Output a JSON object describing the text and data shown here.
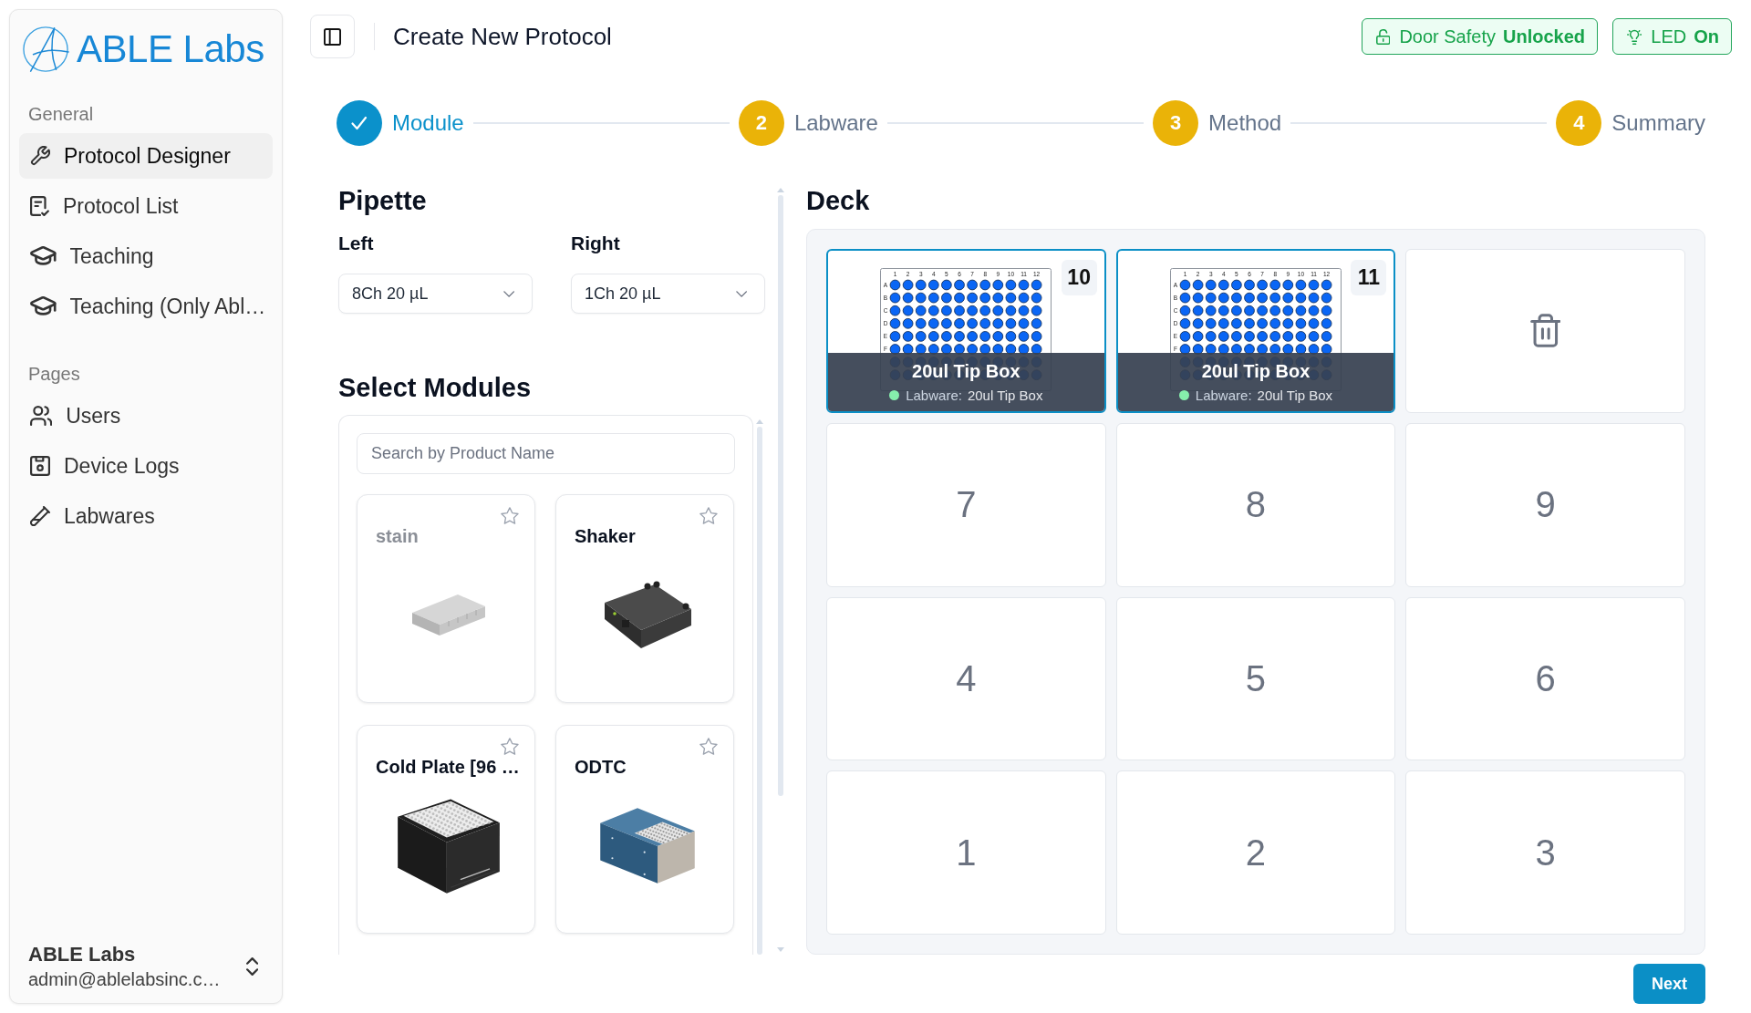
{
  "sidebar": {
    "logo": {
      "text": "ABLE Labs"
    },
    "sections": [
      {
        "label": "General",
        "items": [
          {
            "label": "Protocol Designer",
            "selected": true
          },
          {
            "label": "Protocol List",
            "selected": false
          },
          {
            "label": "Teaching",
            "selected": false
          },
          {
            "label": "Teaching (Only Abl…",
            "selected": false
          }
        ]
      },
      {
        "label": "Pages",
        "items": [
          {
            "label": "Users",
            "selected": false
          },
          {
            "label": "Device Logs",
            "selected": false
          },
          {
            "label": "Labwares",
            "selected": false
          }
        ]
      }
    ],
    "account": {
      "name": "ABLE Labs",
      "email": "admin@ablelabsinc.c…"
    }
  },
  "header": {
    "title": "Create New Protocol",
    "badges": [
      {
        "label": "Door Safety",
        "value": "Unlocked"
      },
      {
        "label": "LED",
        "value": "On"
      }
    ]
  },
  "steps": [
    {
      "label": "Module",
      "completed": true
    },
    {
      "number": "2",
      "label": "Labware",
      "completed": false
    },
    {
      "number": "3",
      "label": "Method",
      "completed": false
    },
    {
      "number": "4",
      "label": "Summary",
      "completed": false
    }
  ],
  "pipette": {
    "title": "Pipette",
    "mounts": [
      {
        "label": "Left",
        "value": "8Ch 20 µL"
      },
      {
        "label": "Right",
        "value": "1Ch 20 µL"
      }
    ]
  },
  "modules": {
    "title": "Select Modules",
    "search": {
      "placeholder": "Search by Product Name"
    },
    "cards": [
      {
        "name": "stain",
        "disabled": true,
        "starred": false
      },
      {
        "name": "Shaker",
        "disabled": false,
        "starred": false
      },
      {
        "name": "Cold Plate [96 …",
        "disabled": false,
        "starred": false
      },
      {
        "name": "ODTC",
        "disabled": false,
        "starred": false
      }
    ]
  },
  "deck": {
    "title": "Deck",
    "slots": [
      {
        "number": "10",
        "kind": "labware",
        "labware": {
          "name": "20ul Tip Box",
          "field_label": "Labware:",
          "field_value": "20ul Tip Box",
          "plate": {
            "columns": [
              "1",
              "2",
              "3",
              "4",
              "5",
              "6",
              "7",
              "8",
              "9",
              "10",
              "11",
              "12"
            ],
            "rows": [
              "A",
              "B",
              "C",
              "D",
              "E",
              "F"
            ]
          }
        }
      },
      {
        "number": "11",
        "kind": "labware",
        "labware": {
          "name": "20ul Tip Box",
          "field_label": "Labware:",
          "field_value": "20ul Tip Box",
          "plate": {
            "columns": [
              "1",
              "2",
              "3",
              "4",
              "5",
              "6",
              "7",
              "8",
              "9",
              "10",
              "11",
              "12"
            ],
            "rows": [
              "A",
              "B",
              "C",
              "D",
              "E",
              "F"
            ]
          }
        }
      },
      {
        "kind": "trash"
      },
      {
        "number": "7",
        "kind": "empty"
      },
      {
        "number": "8",
        "kind": "empty"
      },
      {
        "number": "9",
        "kind": "empty"
      },
      {
        "number": "4",
        "kind": "empty"
      },
      {
        "number": "5",
        "kind": "empty"
      },
      {
        "number": "6",
        "kind": "empty"
      },
      {
        "number": "1",
        "kind": "empty"
      },
      {
        "number": "2",
        "kind": "empty"
      },
      {
        "number": "3",
        "kind": "empty"
      }
    ]
  },
  "next_button": {
    "label": "Next"
  }
}
